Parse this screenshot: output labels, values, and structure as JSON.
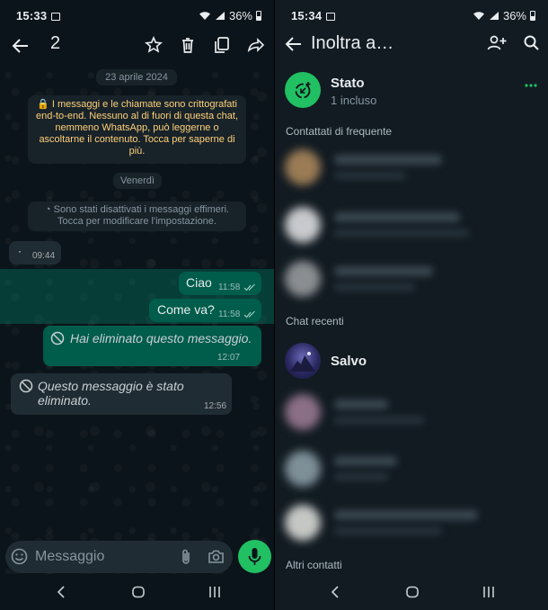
{
  "left": {
    "status": {
      "time": "15:33",
      "battery": "36%"
    },
    "selection_count": "2",
    "date_pill": "23 aprile 2024",
    "encryption_notice": "🔒 I messaggi e le chiamate sono crittografati end-to-end. Nessuno al di fuori di questa chat, nemmeno WhatsApp, può leggerne o ascoltarne il contenuto. Tocca per saperne di più.",
    "day_pill": "Venerdì",
    "ephemeral_notice": "Sono stati disattivati i messaggi effimeri. Tocca per modificare l'impostazione.",
    "messages": [
      {
        "text": "·",
        "time": "09:44"
      },
      {
        "text": "Ciao",
        "time": "11:58"
      },
      {
        "text": "Come va?",
        "time": "11:58"
      },
      {
        "text": "Hai eliminato questo messaggio.",
        "time": "12:07"
      },
      {
        "text": "Questo messaggio è stato eliminato.",
        "time": "12:56"
      }
    ],
    "composer_placeholder": "Messaggio"
  },
  "right": {
    "status": {
      "time": "15:34",
      "battery": "36%"
    },
    "title": "Inoltra a…",
    "status_item": {
      "name": "Stato",
      "sub": "1 incluso"
    },
    "section_frequent": "Contattati di frequente",
    "section_recent": "Chat recenti",
    "recent_named": "Salvo",
    "section_other": "Altri contatti"
  },
  "colors": {
    "accent": "#21c063",
    "outgoing": "#005c4b",
    "incoming": "#202c33",
    "notice_text": "#ffd279"
  },
  "icons": [
    "back-arrow-icon",
    "star-icon",
    "trash-icon",
    "copy-icon",
    "forward-icon",
    "emoji-icon",
    "attach-icon",
    "camera-icon",
    "mic-icon",
    "add-contact-icon",
    "search-icon",
    "status-icon",
    "more-icon"
  ]
}
